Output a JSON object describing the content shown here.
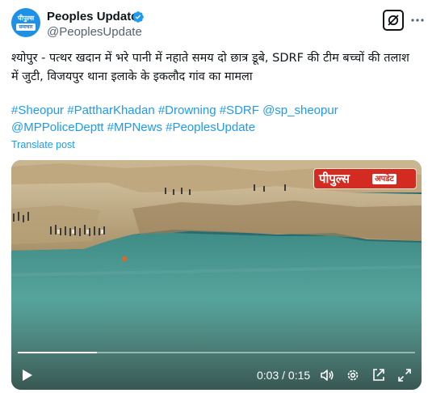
{
  "author": {
    "name": "Peoples Update",
    "handle": "@PeoplesUpdate",
    "avatar_text_top": "पीपुल्स",
    "avatar_text_bottom": "समाचार",
    "verified_icon": "verified-badge-icon",
    "verified_color": "#1d9bf0"
  },
  "header_actions": {
    "grok_icon": "grok-icon",
    "more_icon": "more-options-icon"
  },
  "post": {
    "text": "श्योपुर - पत्थर खदान में भरे पानी में नहाते समय दो छात्र डूबे, SDRF की टीम बच्चों की तलाश में जुटी, विजयपुर थाना इलाके के इकलौद गांव का मामला",
    "hashtags": [
      "#Sheopur",
      "#PattharKhadan",
      "#Drowning",
      "#SDRF",
      "@sp_sheopur",
      "@MPPoliceDeptt",
      "#MPNews",
      "#PeoplesUpdate"
    ],
    "translate_label": "Translate post",
    "link_color": "#1d9bf0"
  },
  "video": {
    "channel_logo_main": "पीपुल्स",
    "channel_logo_sub": "अपडेट",
    "current_time": "0:03",
    "duration": "0:15",
    "time_display": "0:03 / 0:15",
    "progress": 0.2,
    "controls": {
      "play_icon": "play-icon",
      "volume_icon": "volume-icon",
      "settings_icon": "settings-gear-icon",
      "pip_icon": "picture-in-picture-icon",
      "fullscreen_icon": "fullscreen-icon"
    }
  }
}
